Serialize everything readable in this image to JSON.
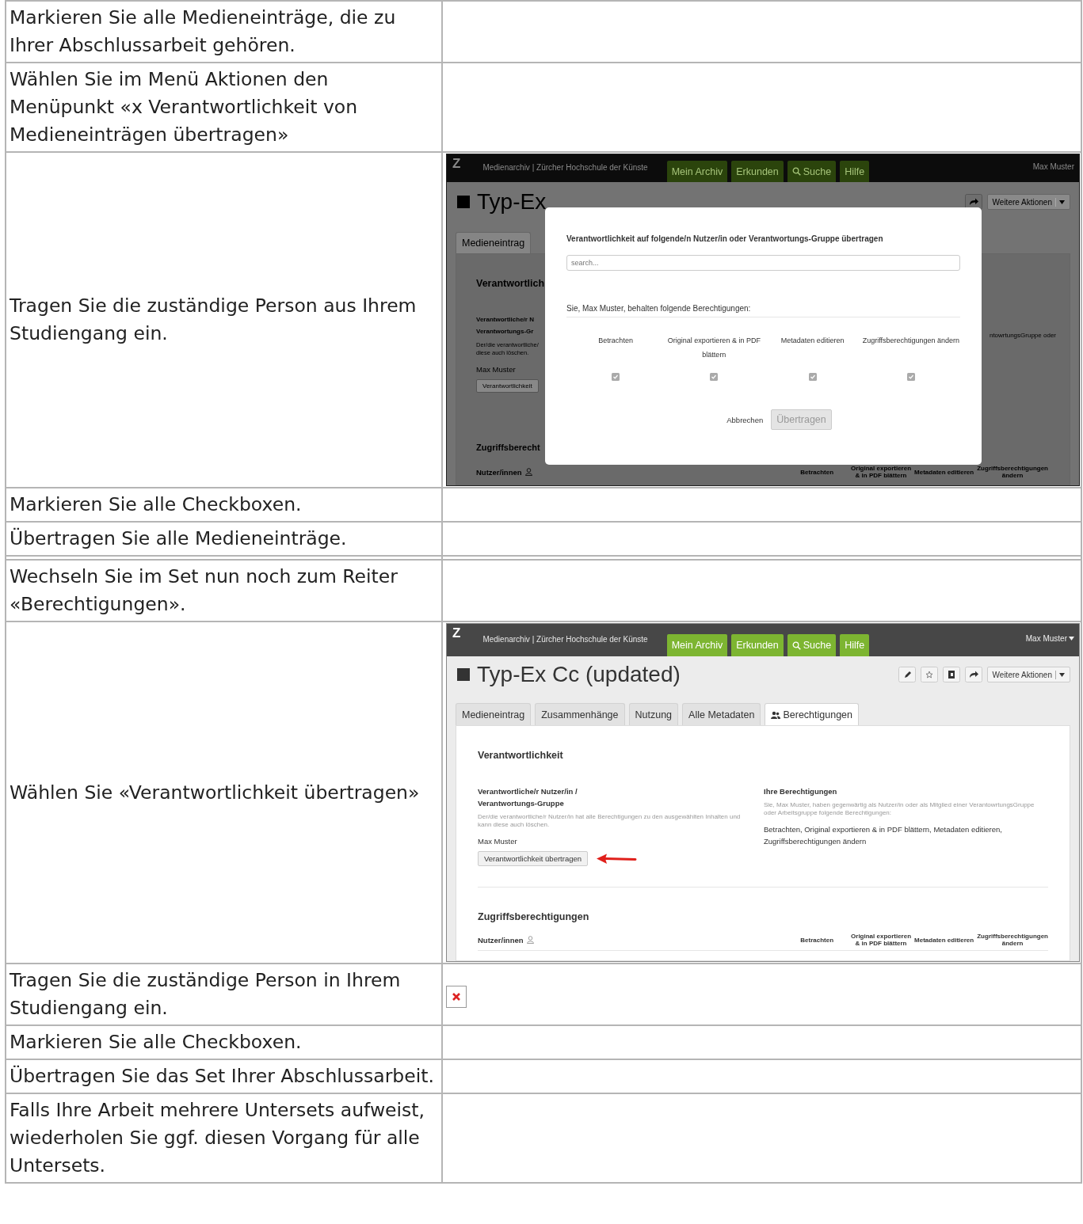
{
  "rows": [
    {
      "kind": "text",
      "instruction": "Markieren Sie alle Medieneinträge, die zu Ihrer Abschlussarbeit gehören."
    },
    {
      "kind": "text",
      "instruction": "Wählen Sie im Menü Aktionen den Menüpunkt «x Verantwortlichkeit von Medieneinträgen übertragen»"
    },
    {
      "kind": "screenshot",
      "instruction": "Tragen Sie die zuständige Person aus Ihrem Studiengang ein.",
      "screenshot": {
        "kind": "dialog",
        "logo": "Z",
        "site": "Medienarchiv | Zürcher Hochschule der Künste",
        "menu": [
          {
            "label": "Mein Archiv",
            "kind": "link"
          },
          {
            "label": "Erkunden",
            "kind": "link"
          },
          {
            "label": "Suche",
            "kind": "search"
          },
          {
            "label": "Hilfe",
            "kind": "link"
          }
        ],
        "user": "Max Muster",
        "title": "Typ-Ex",
        "actions_label": "Weitere Aktionen",
        "tabs": [
          {
            "label": "Medieneintrag",
            "selected": false
          }
        ],
        "responsibility": {
          "heading": "Verantwortlich",
          "label": "Verantwortliche/r N\nVerantwortungs-Gr",
          "description": "Der/die verantwortliche/\ndiese auch löschen.",
          "owner": "Max Muster",
          "button": "Verantwortlichkeit"
        },
        "my_permissions": {
          "description": "ntowrtungsGruppe oder"
        },
        "access": {
          "heading": "Zugriffsberecht",
          "users_label": "Nutzer/innen",
          "columns": [
            "Betrachten",
            "Original exportieren\n& in PDF blättern",
            "Metadaten editieren",
            "Zugriffsberechtigungen\nändern"
          ]
        },
        "modal": {
          "title": "Verantwortlichkeit auf folgende/n Nutzer/in oder Verantwortungs-Gruppe übertragen",
          "placeholder": "search...",
          "keep_text": "Sie, Max Muster, behalten folgende Berechtigungen:",
          "permissions": [
            {
              "label": "Betrachten",
              "checked": true
            },
            {
              "label": "Original exportieren & in PDF blättern",
              "checked": true
            },
            {
              "label": "Metadaten editieren",
              "checked": true
            },
            {
              "label": "Zugriffsberechtigungen ändern",
              "checked": true
            }
          ],
          "cancel": "Abbrechen",
          "submit": {
            "label": "Übertragen",
            "disabled": true
          }
        }
      }
    },
    {
      "kind": "text",
      "instruction": "Markieren Sie alle Checkboxen."
    },
    {
      "kind": "text",
      "instruction": "Übertragen Sie alle Medieneinträge."
    },
    {
      "kind": "empty"
    },
    {
      "kind": "text",
      "instruction": "Wechseln Sie im Set nun noch zum Reiter «Berechtigungen»."
    },
    {
      "kind": "screenshot",
      "instruction": "Wählen Sie «Verantwortlichkeit übertragen»",
      "screenshot": {
        "kind": "page",
        "logo": "Z",
        "site": "Medienarchiv | Zürcher Hochschule der Künste",
        "menu": [
          {
            "label": "Mein Archiv",
            "kind": "link"
          },
          {
            "label": "Erkunden",
            "kind": "link"
          },
          {
            "label": "Suche",
            "kind": "search"
          },
          {
            "label": "Hilfe",
            "kind": "link"
          }
        ],
        "user": "Max Muster",
        "title": "Typ-Ex Cc (updated)",
        "actions_label": "Weitere Aktionen",
        "tabs": [
          {
            "label": "Medieneintrag",
            "selected": false
          },
          {
            "label": "Zusammenhänge",
            "selected": false
          },
          {
            "label": "Nutzung",
            "selected": false
          },
          {
            "label": "Alle Metadaten",
            "selected": false
          },
          {
            "label": "Berechtigungen",
            "selected": true
          }
        ],
        "responsibility": {
          "heading": "Verantwortlichkeit",
          "label": "Verantwortliche/r Nutzer/in /\nVerantwortungs-Gruppe",
          "description": "Der/die verantwortliche/r Nutzer/in hat alle Berechtigungen zu den ausgewählten Inhalten und kann diese auch löschen.",
          "owner": "Max Muster",
          "button": "Verantwortlichkeit übertragen",
          "pointer_arrow": true
        },
        "my_permissions": {
          "heading": "Ihre Berechtigungen",
          "description": "Sie, Max Muster, haben gegenwärtig als Nutzer/in oder als Mitglied einer VerantowrtungsGruppe oder Arbeitsgruppe folgende Berechtigungen:",
          "value": "Betrachten, Original exportieren & in PDF blättern, Metadaten editieren, Zugriffsberechtigungen ändern"
        },
        "access": {
          "heading": "Zugriffsberechtigungen",
          "users_label": "Nutzer/innen",
          "columns": [
            "Betrachten",
            "Original exportieren\n& in PDF blättern",
            "Metadaten editieren",
            "Zugriffsberechtigungen\nändern"
          ]
        }
      }
    },
    {
      "kind": "broken_image",
      "instruction": "Tragen Sie die zuständige Person in Ihrem Studiengang ein."
    },
    {
      "kind": "text",
      "instruction": "Markieren Sie alle Checkboxen."
    },
    {
      "kind": "text",
      "instruction": "Übertragen Sie das Set Ihrer Abschlussarbeit."
    },
    {
      "kind": "text",
      "instruction": "Falls Ihre Arbeit mehrere Untersets aufweist, wiederholen Sie ggf. diesen Vorgang für alle Untersets."
    }
  ]
}
